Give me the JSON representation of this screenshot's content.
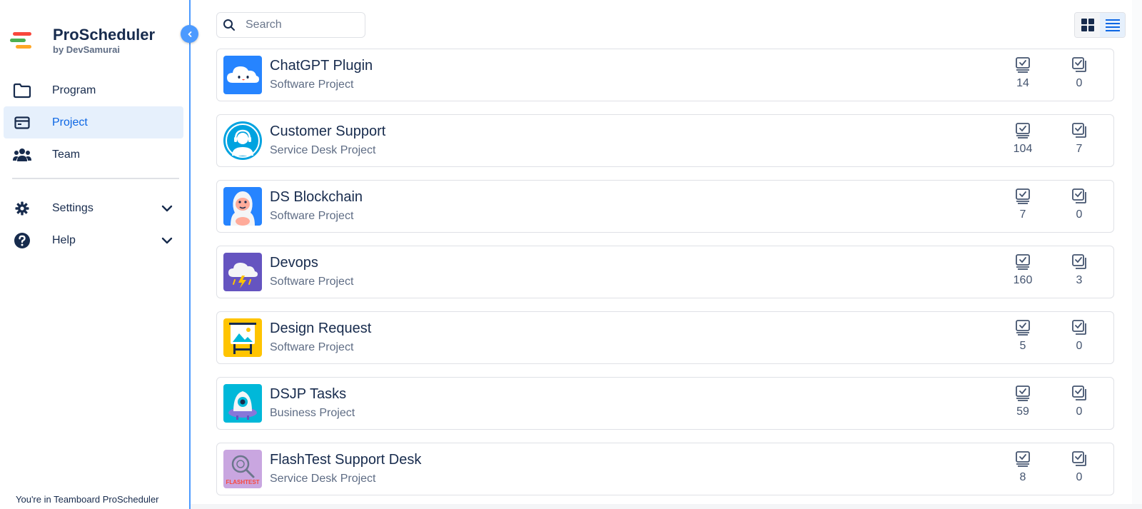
{
  "app": {
    "title": "ProScheduler",
    "subtitle": "by DevSamurai",
    "footer": "You're in Teamboard ProScheduler"
  },
  "sidebar": {
    "items": [
      {
        "label": "Program",
        "icon": "folder-icon",
        "active": false
      },
      {
        "label": "Project",
        "icon": "window-icon",
        "active": true
      },
      {
        "label": "Team",
        "icon": "people-icon",
        "active": false
      }
    ],
    "secondary": [
      {
        "label": "Settings",
        "icon": "gear-icon"
      },
      {
        "label": "Help",
        "icon": "help-circle-icon"
      }
    ]
  },
  "search": {
    "placeholder": "Search",
    "value": ""
  },
  "view_toggle": {
    "options": [
      "grid-view-icon",
      "list-view-icon"
    ],
    "selected": "list"
  },
  "colors": {
    "accent": "#0c66e4",
    "sidebar_active_bg": "#e6f0fc",
    "collapse_button": "#4c9aff",
    "text_primary": "#172b4d",
    "text_secondary": "#5e6c84"
  },
  "projects": [
    {
      "name": "ChatGPT Plugin",
      "type": "Software Project",
      "issues": "14",
      "subtasks": "0",
      "avatar": "cloud-icon",
      "avatar_color": "#2684ff"
    },
    {
      "name": "Customer Support",
      "type": "Service Desk Project",
      "issues": "104",
      "subtasks": "7",
      "avatar": "headset-agent-icon",
      "avatar_color": "#00a3e0"
    },
    {
      "name": "DS Blockchain",
      "type": "Software Project",
      "issues": "7",
      "subtasks": "0",
      "avatar": "yeti-icon",
      "avatar_color": "#2684ff"
    },
    {
      "name": "Devops",
      "type": "Software Project",
      "issues": "160",
      "subtasks": "3",
      "avatar": "storm-cloud-icon",
      "avatar_color": "#6554c0"
    },
    {
      "name": "Design Request",
      "type": "Software Project",
      "issues": "5",
      "subtasks": "0",
      "avatar": "easel-icon",
      "avatar_color": "#ffc400"
    },
    {
      "name": "DSJP Tasks",
      "type": "Business Project",
      "issues": "59",
      "subtasks": "0",
      "avatar": "ufo-icon",
      "avatar_color": "#00b8d9"
    },
    {
      "name": "FlashTest Support Desk",
      "type": "Service Desk Project",
      "issues": "8",
      "subtasks": "0",
      "avatar": "flashtest-logo-icon",
      "avatar_color": "#c9a6e0",
      "avatar_text": "FLASHTEST"
    }
  ]
}
